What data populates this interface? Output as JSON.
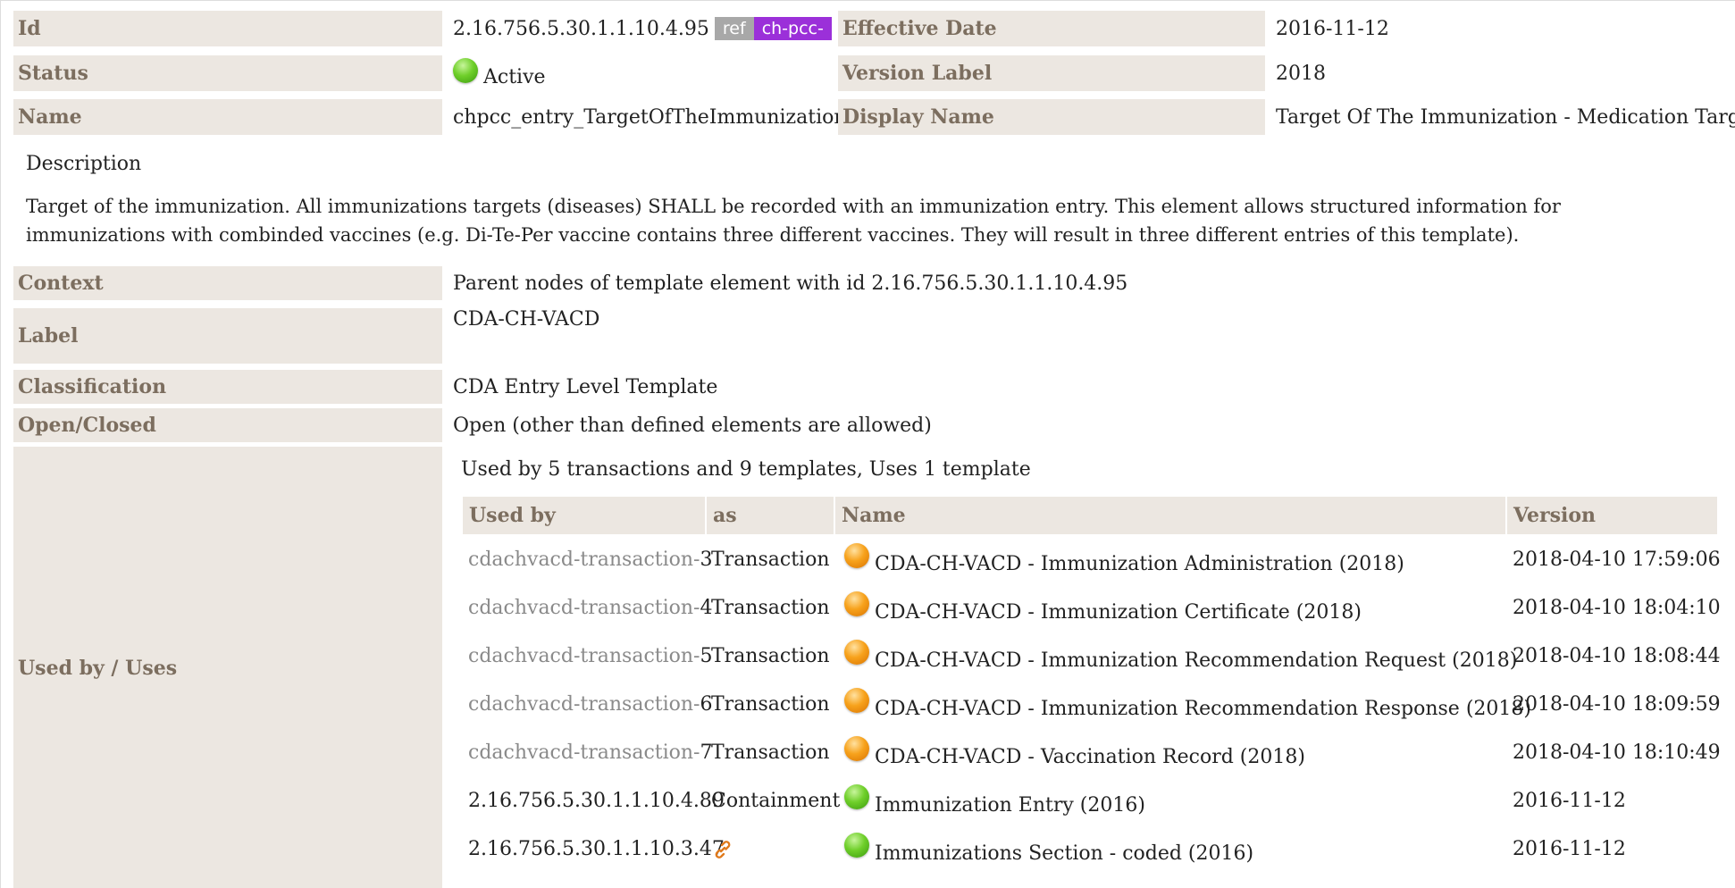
{
  "header": {
    "id_label": "Id",
    "id_value": "2.16.756.5.30.1.1.10.4.95",
    "ref_badge": "ref",
    "prefix_badge": "ch-pcc-",
    "effective_date_label": "Effective Date",
    "effective_date_value": "2016-11-12",
    "status_label": "Status",
    "status_value": "Active",
    "version_label_label": "Version Label",
    "version_label_value": "2018",
    "name_label": "Name",
    "name_value": "chpcc_entry_TargetOfTheImmunization",
    "display_name_label": "Display Name",
    "display_name_value": "Target Of The Immunization - Medication Target"
  },
  "description": {
    "title": "Description",
    "text": "Target of the immunization. All immunizations targets (diseases) SHALL be recorded with an immunization entry. This element allows structured information for immunizations with combinded vaccines (e.g. Di-Te-Per vaccine contains three different vaccines. They will result in three different entries of this template)."
  },
  "properties": {
    "context_label": "Context",
    "context_value": "Parent nodes of template element with id 2.16.756.5.30.1.1.10.4.95",
    "label_label": "Label",
    "label_value": "CDA-CH-VACD",
    "classification_label": "Classification",
    "classification_value": "CDA Entry Level Template",
    "open_closed_label": "Open/Closed",
    "open_closed_value": "Open (other than defined elements are allowed)",
    "used_by_label": "Used by / Uses"
  },
  "usage": {
    "summary": "Used by 5 transactions and 9 templates, Uses 1 template",
    "columns": [
      "Used by",
      "as",
      "Name",
      "Version"
    ],
    "rows": [
      {
        "used_by_prefix": "cdachvacd-transaction-",
        "used_by_num": "3",
        "as": "Transaction",
        "status": "orange",
        "name": "CDA-CH-VACD - Immunization Administration (2018)",
        "version": "2018-04-10 17:59:06"
      },
      {
        "used_by_prefix": "cdachvacd-transaction-",
        "used_by_num": "4",
        "as": "Transaction",
        "status": "orange",
        "name": "CDA-CH-VACD - Immunization Certificate (2018)",
        "version": "2018-04-10 18:04:10"
      },
      {
        "used_by_prefix": "cdachvacd-transaction-",
        "used_by_num": "5",
        "as": "Transaction",
        "status": "orange",
        "name": "CDA-CH-VACD - Immunization Recommendation Request (2018)",
        "version": "2018-04-10 18:08:44"
      },
      {
        "used_by_prefix": "cdachvacd-transaction-",
        "used_by_num": "6",
        "as": "Transaction",
        "status": "orange",
        "name": "CDA-CH-VACD - Immunization Recommendation Response (2018)",
        "version": "2018-04-10 18:09:59"
      },
      {
        "used_by_prefix": "cdachvacd-transaction-",
        "used_by_num": "7",
        "as": "Transaction",
        "status": "orange",
        "name": "CDA-CH-VACD - Vaccination Record (2018)",
        "version": "2018-04-10 18:10:49"
      },
      {
        "used_by_prefix": "",
        "used_by_num": "2.16.756.5.30.1.1.10.4.89",
        "as": "Containment",
        "status": "green",
        "name": "Immunization Entry (2016)",
        "version": "2016-11-12"
      },
      {
        "used_by_prefix": "",
        "used_by_num": "2.16.756.5.30.1.1.10.3.47",
        "as": "",
        "as_icon": "link-icon",
        "status": "green",
        "name": "Immunizations Section - coded (2016)",
        "version": "2016-11-12"
      }
    ]
  },
  "colors": {
    "label_bg": "#ece7e1",
    "label_text": "#7c6e5f",
    "prefix_badge": "#9b30d9",
    "ref_badge": "#a8a8a8"
  }
}
